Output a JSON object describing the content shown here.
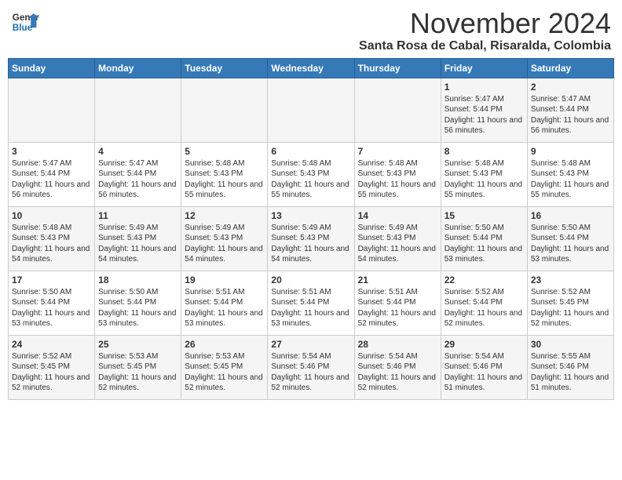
{
  "header": {
    "logo_line1": "General",
    "logo_line2": "Blue",
    "month_title": "November 2024",
    "subtitle": "Santa Rosa de Cabal, Risaralda, Colombia"
  },
  "days_of_week": [
    "Sunday",
    "Monday",
    "Tuesday",
    "Wednesday",
    "Thursday",
    "Friday",
    "Saturday"
  ],
  "weeks": [
    [
      {
        "day": "",
        "info": ""
      },
      {
        "day": "",
        "info": ""
      },
      {
        "day": "",
        "info": ""
      },
      {
        "day": "",
        "info": ""
      },
      {
        "day": "",
        "info": ""
      },
      {
        "day": "1",
        "info": "Sunrise: 5:47 AM\nSunset: 5:44 PM\nDaylight: 11 hours and 56 minutes."
      },
      {
        "day": "2",
        "info": "Sunrise: 5:47 AM\nSunset: 5:44 PM\nDaylight: 11 hours and 56 minutes."
      }
    ],
    [
      {
        "day": "3",
        "info": "Sunrise: 5:47 AM\nSunset: 5:44 PM\nDaylight: 11 hours and 56 minutes."
      },
      {
        "day": "4",
        "info": "Sunrise: 5:47 AM\nSunset: 5:44 PM\nDaylight: 11 hours and 56 minutes."
      },
      {
        "day": "5",
        "info": "Sunrise: 5:48 AM\nSunset: 5:43 PM\nDaylight: 11 hours and 55 minutes."
      },
      {
        "day": "6",
        "info": "Sunrise: 5:48 AM\nSunset: 5:43 PM\nDaylight: 11 hours and 55 minutes."
      },
      {
        "day": "7",
        "info": "Sunrise: 5:48 AM\nSunset: 5:43 PM\nDaylight: 11 hours and 55 minutes."
      },
      {
        "day": "8",
        "info": "Sunrise: 5:48 AM\nSunset: 5:43 PM\nDaylight: 11 hours and 55 minutes."
      },
      {
        "day": "9",
        "info": "Sunrise: 5:48 AM\nSunset: 5:43 PM\nDaylight: 11 hours and 55 minutes."
      }
    ],
    [
      {
        "day": "10",
        "info": "Sunrise: 5:48 AM\nSunset: 5:43 PM\nDaylight: 11 hours and 54 minutes."
      },
      {
        "day": "11",
        "info": "Sunrise: 5:49 AM\nSunset: 5:43 PM\nDaylight: 11 hours and 54 minutes."
      },
      {
        "day": "12",
        "info": "Sunrise: 5:49 AM\nSunset: 5:43 PM\nDaylight: 11 hours and 54 minutes."
      },
      {
        "day": "13",
        "info": "Sunrise: 5:49 AM\nSunset: 5:43 PM\nDaylight: 11 hours and 54 minutes."
      },
      {
        "day": "14",
        "info": "Sunrise: 5:49 AM\nSunset: 5:43 PM\nDaylight: 11 hours and 54 minutes."
      },
      {
        "day": "15",
        "info": "Sunrise: 5:50 AM\nSunset: 5:44 PM\nDaylight: 11 hours and 53 minutes."
      },
      {
        "day": "16",
        "info": "Sunrise: 5:50 AM\nSunset: 5:44 PM\nDaylight: 11 hours and 53 minutes."
      }
    ],
    [
      {
        "day": "17",
        "info": "Sunrise: 5:50 AM\nSunset: 5:44 PM\nDaylight: 11 hours and 53 minutes."
      },
      {
        "day": "18",
        "info": "Sunrise: 5:50 AM\nSunset: 5:44 PM\nDaylight: 11 hours and 53 minutes."
      },
      {
        "day": "19",
        "info": "Sunrise: 5:51 AM\nSunset: 5:44 PM\nDaylight: 11 hours and 53 minutes."
      },
      {
        "day": "20",
        "info": "Sunrise: 5:51 AM\nSunset: 5:44 PM\nDaylight: 11 hours and 53 minutes."
      },
      {
        "day": "21",
        "info": "Sunrise: 5:51 AM\nSunset: 5:44 PM\nDaylight: 11 hours and 52 minutes."
      },
      {
        "day": "22",
        "info": "Sunrise: 5:52 AM\nSunset: 5:44 PM\nDaylight: 11 hours and 52 minutes."
      },
      {
        "day": "23",
        "info": "Sunrise: 5:52 AM\nSunset: 5:45 PM\nDaylight: 11 hours and 52 minutes."
      }
    ],
    [
      {
        "day": "24",
        "info": "Sunrise: 5:52 AM\nSunset: 5:45 PM\nDaylight: 11 hours and 52 minutes."
      },
      {
        "day": "25",
        "info": "Sunrise: 5:53 AM\nSunset: 5:45 PM\nDaylight: 11 hours and 52 minutes."
      },
      {
        "day": "26",
        "info": "Sunrise: 5:53 AM\nSunset: 5:45 PM\nDaylight: 11 hours and 52 minutes."
      },
      {
        "day": "27",
        "info": "Sunrise: 5:54 AM\nSunset: 5:46 PM\nDaylight: 11 hours and 52 minutes."
      },
      {
        "day": "28",
        "info": "Sunrise: 5:54 AM\nSunset: 5:46 PM\nDaylight: 11 hours and 52 minutes."
      },
      {
        "day": "29",
        "info": "Sunrise: 5:54 AM\nSunset: 5:46 PM\nDaylight: 11 hours and 51 minutes."
      },
      {
        "day": "30",
        "info": "Sunrise: 5:55 AM\nSunset: 5:46 PM\nDaylight: 11 hours and 51 minutes."
      }
    ]
  ]
}
